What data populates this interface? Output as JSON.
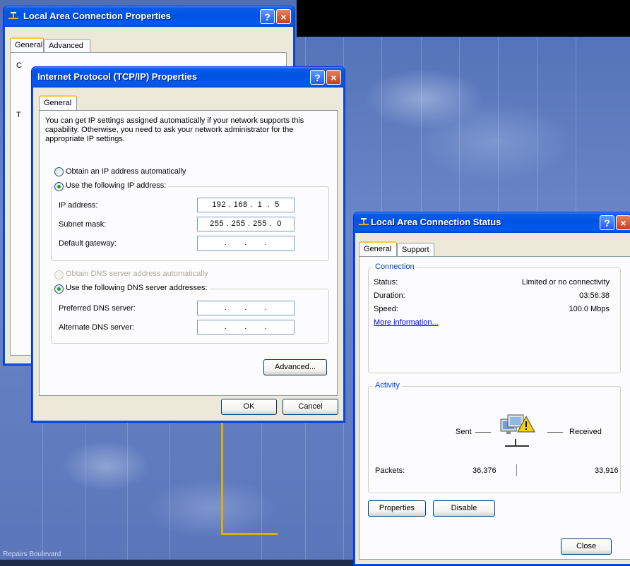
{
  "desktop": {
    "bottom_text": "Repairs       Boulevard"
  },
  "lac_props": {
    "title": "Local Area Connection Properties",
    "tabs": [
      "General",
      "Advanced"
    ],
    "partial_labels": [
      "C",
      "T"
    ]
  },
  "tcpip": {
    "title": "Internet Protocol (TCP/IP) Properties",
    "tab": "General",
    "description": "You can get IP settings assigned automatically if your network supports this capability. Otherwise, you need to ask your network administrator for the appropriate IP settings.",
    "radio_auto_ip": "Obtain an IP address automatically",
    "radio_manual_ip": "Use the following IP address:",
    "ip_label": "IP address:",
    "ip_value": "192 . 168 .  1  .  5",
    "subnet_label": "Subnet mask:",
    "subnet_value": "255 . 255 . 255 .  0",
    "gateway_label": "Default gateway:",
    "gateway_value": "  .       .       .  ",
    "radio_auto_dns": "Obtain DNS server address automatically",
    "radio_manual_dns": "Use the following DNS server addresses:",
    "pref_dns_label": "Preferred DNS server:",
    "pref_dns_value": "  .       .       .  ",
    "alt_dns_label": "Alternate DNS server:",
    "alt_dns_value": "  .       .       .  ",
    "advanced_btn": "Advanced...",
    "ok_btn": "OK",
    "cancel_btn": "Cancel"
  },
  "status": {
    "title": "Local Area Connection Status",
    "tabs": [
      "General",
      "Support"
    ],
    "connection_legend": "Connection",
    "status_label": "Status:",
    "status_value": "Limited or no connectivity",
    "duration_label": "Duration:",
    "duration_value": "03:56:38",
    "speed_label": "Speed:",
    "speed_value": "100.0 Mbps",
    "more_info": "More information...",
    "activity_legend": "Activity",
    "sent_label": "Sent",
    "received_label": "Received",
    "packets_label": "Packets:",
    "packets_sent": "36,376",
    "packets_received": "33,916",
    "properties_btn": "Properties",
    "disable_btn": "Disable",
    "close_btn": "Close"
  },
  "icons": {
    "help": "?",
    "close": "×",
    "network": "network-icon",
    "warning": "warning-icon"
  },
  "colors": {
    "titlebar": "#0054e3",
    "group_legend": "#0046d5",
    "link": "#0000ff",
    "tab_highlight": "#ffc83c"
  }
}
